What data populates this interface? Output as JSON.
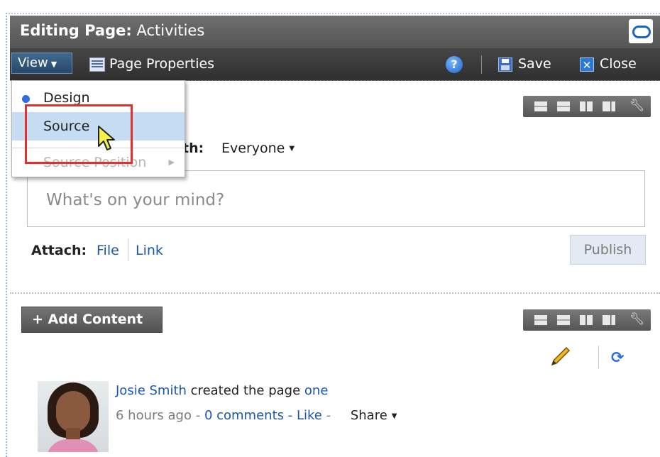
{
  "header": {
    "title_prefix": "Editing Page:",
    "title_page": "Activities"
  },
  "toolbar": {
    "view_label": "View",
    "page_properties_label": "Page Properties",
    "help_glyph": "?",
    "save_label": "Save",
    "close_label": "Close"
  },
  "view_menu": {
    "items": [
      {
        "label": "Design",
        "selected": true,
        "enabled": true
      },
      {
        "label": "Source",
        "selected": false,
        "enabled": true,
        "highlighted": true
      },
      {
        "label": "Source Position",
        "selected": false,
        "enabled": false,
        "has_submenu": true
      }
    ]
  },
  "publisher": {
    "share_with_label": "Share with:",
    "share_with_visible": "th:",
    "share_target": "Everyone",
    "placeholder": "What's on your mind?",
    "attach_label": "Attach:",
    "attach_file": "File",
    "attach_link": "Link",
    "publish_label": "Publish"
  },
  "content": {
    "add_content_label": "Add Content"
  },
  "activity": {
    "user": "Josie Smith",
    "action": "created the page",
    "page_link": "one",
    "time": "6 hours ago",
    "comments": "0 comments",
    "like": "Like",
    "share": "Share"
  },
  "colors": {
    "titlebar": "#5f5f5f",
    "toolbar": "#3a3a3a",
    "menu_highlight": "#c6dcf3",
    "link": "#1a57a8",
    "highlight_box": "#e3302c"
  }
}
